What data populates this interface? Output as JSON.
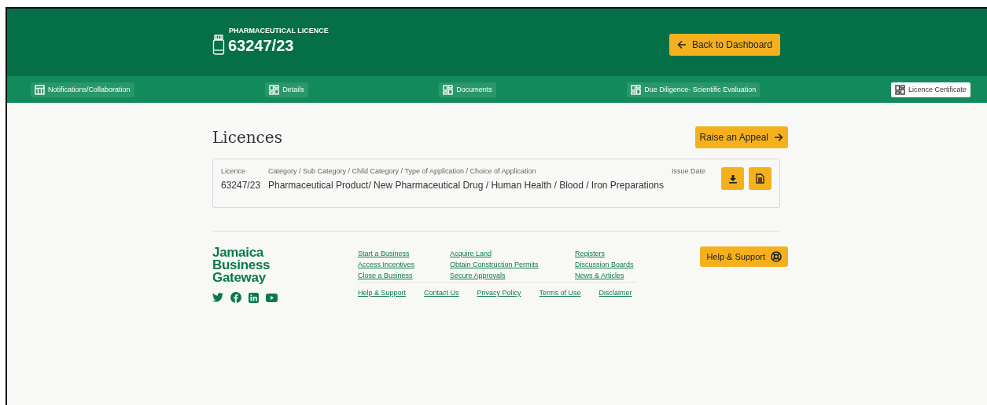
{
  "header": {
    "eyebrow": "PHARMACEUTICAL LICENCE",
    "title": "63247/23",
    "back_button": "Back to Dashboard"
  },
  "tabs": [
    {
      "label": "Notifications/Collaboration",
      "kind": "table",
      "selected": false
    },
    {
      "label": "Details",
      "kind": "grid",
      "selected": false
    },
    {
      "label": "Documents",
      "kind": "grid",
      "selected": false
    },
    {
      "label": "Due Diligence- Scientific Evaluation",
      "kind": "grid",
      "selected": false
    },
    {
      "label": "Licence Certificate",
      "kind": "grid",
      "selected": true
    }
  ],
  "page_title": "Licences",
  "appeal_button": "Raise an Appeal",
  "licence_card": {
    "columns": [
      "Licence",
      "Category / Sub Category / Child Category / Type of Application / Choice of Application",
      "Issue Date"
    ],
    "row": [
      "63247/23",
      "Pharmaceutical Product/ New Pharmaceutical Drug / Human Health / Blood / Iron Preparations"
    ]
  },
  "footer": {
    "logo": [
      "Jamaica",
      "Business",
      "Gateway"
    ],
    "link_columns": [
      [
        "Start a Business",
        "Access Incentives",
        "Close a Business"
      ],
      [
        "Acquire Land",
        "Obtain Construction Permits",
        "Secure Approvals"
      ],
      [
        "Registers",
        "Discussion Boards",
        "News & Articles"
      ]
    ],
    "bottom_links": [
      "Help & Support",
      "Contact Us",
      "Privacy Policy",
      "Terms of Use",
      "Disclaimer"
    ],
    "help_button": "Help & Support"
  }
}
